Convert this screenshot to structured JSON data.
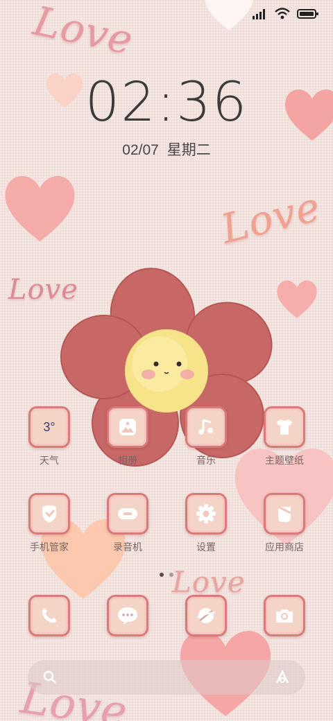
{
  "status": {
    "signal_icon": "signal-icon",
    "wifi_icon": "wifi-icon",
    "battery_icon": "battery-icon"
  },
  "clock": {
    "time": "02:36",
    "date": "02/07",
    "weekday": "星期二"
  },
  "wallpaper": {
    "love_words": [
      "Love",
      "Love",
      "Love",
      "Love",
      "Love"
    ]
  },
  "apps_row1": [
    {
      "label": "天气",
      "icon": "weather-icon",
      "icon_text": "3°"
    },
    {
      "label": "相册",
      "icon": "gallery-icon"
    },
    {
      "label": "音乐",
      "icon": "music-icon"
    },
    {
      "label": "主题壁纸",
      "icon": "themes-icon"
    }
  ],
  "apps_row2": [
    {
      "label": "手机管家",
      "icon": "security-icon"
    },
    {
      "label": "录音机",
      "icon": "recorder-icon"
    },
    {
      "label": "设置",
      "icon": "settings-icon"
    },
    {
      "label": "应用商店",
      "icon": "app-store-icon"
    }
  ],
  "dock": [
    {
      "icon": "phone-icon"
    },
    {
      "icon": "messages-icon"
    },
    {
      "icon": "browser-icon"
    },
    {
      "icon": "camera-icon"
    }
  ],
  "page_indicator": {
    "count": 2,
    "active": 0
  },
  "search": {
    "search_icon": "search-icon",
    "assistant_icon": "assistant-icon"
  },
  "colors": {
    "tile_border": "#d87b78",
    "tile_fill": "#f3d4c7",
    "flower": "#c86866",
    "flower_center": "#f7e38a",
    "heart": "#f4a5a3"
  }
}
